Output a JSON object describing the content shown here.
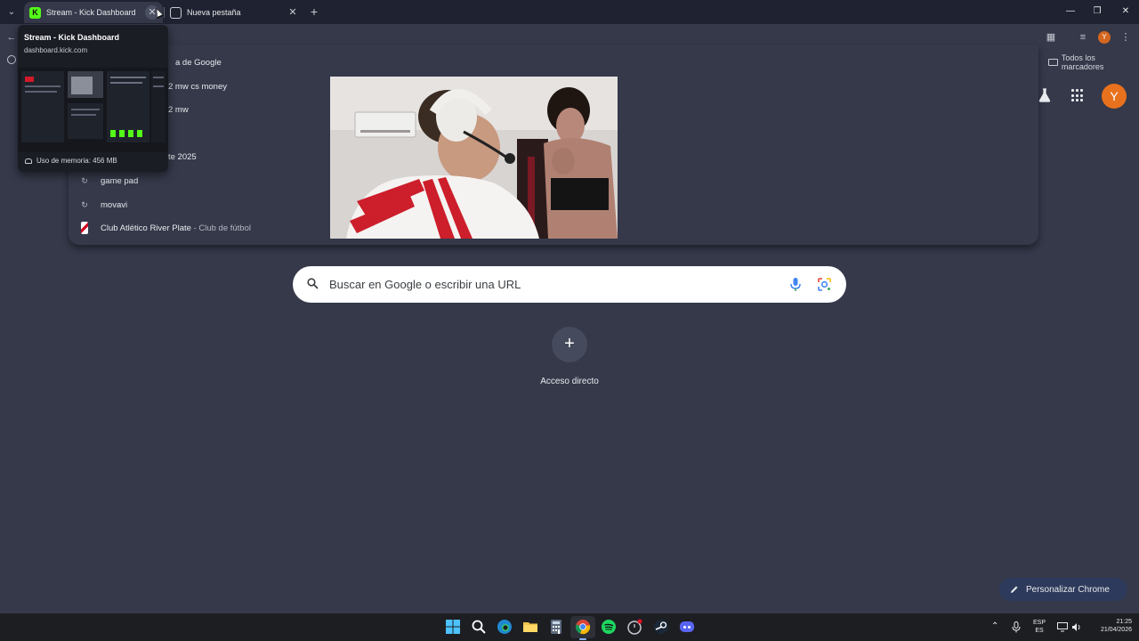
{
  "tabs": [
    {
      "title": "Stream - Kick Dashboard",
      "favicon": "kick-icon",
      "active": true
    },
    {
      "title": "Nueva pestaña",
      "favicon": "globe-icon",
      "active": false
    }
  ],
  "hovercard": {
    "title": "Stream - Kick Dashboard",
    "url": "dashboard.kick.com",
    "memory": "Uso de memoria: 456 MB"
  },
  "toolbar": {
    "avatar_letter": "Y",
    "bookmarks_label": "Todos los marcadores"
  },
  "suggestions": [
    {
      "text": "a de Google",
      "sub": "",
      "icon": "clock-icon"
    },
    {
      "text": "2 mw cs money",
      "sub": "",
      "icon": "clock-icon"
    },
    {
      "text": "2 mw",
      "sub": "",
      "icon": "clock-icon"
    },
    {
      "text": "te 2025",
      "sub": "",
      "icon": "clock-icon"
    },
    {
      "text": "game pad",
      "sub": "",
      "icon": "clock-icon"
    },
    {
      "text": "movavi",
      "sub": "",
      "icon": "clock-icon"
    },
    {
      "text": "Club Atlético River Plate",
      "sub": " - Club de fútbol",
      "icon": "river-plate-badge"
    }
  ],
  "ntp": {
    "avatar_letter": "Y",
    "search_placeholder": "Buscar en Google o escribir una URL",
    "shortcut_plus": "+",
    "shortcut_label": "Acceso directo",
    "customize_label": "Personalizar Chrome"
  },
  "tray": {
    "lang_top": "ESP",
    "lang_bottom": "ES",
    "time": "21:25",
    "date": "21/04/2026"
  },
  "colors": {
    "background": "#35394a",
    "tabstrip": "#1f2230",
    "kick_green": "#53fc18",
    "avatar_orange": "#e8711d"
  }
}
